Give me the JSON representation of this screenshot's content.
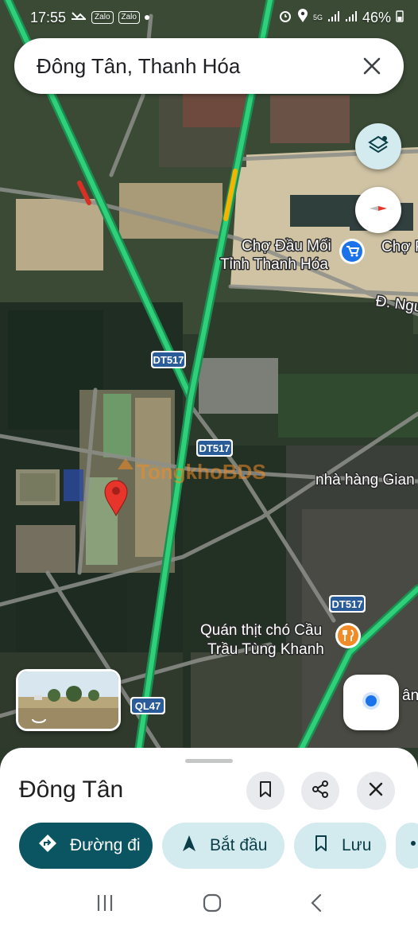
{
  "status_bar": {
    "time": "17:55",
    "notif_chip_1": "Zalo",
    "notif_chip_2": "Zalo",
    "network": "5G",
    "battery": "46%"
  },
  "search": {
    "query": "Đông Tân, Thanh Hóa"
  },
  "map": {
    "labels": {
      "market_line1": "Chợ Đầu Mối",
      "market_line2": "Tỉnh Thanh Hóa",
      "market2": "Chợ P",
      "street": "Đ. Ngu",
      "restaurant": "nhà hàng Gian",
      "dog_meat_line1": "Quán thịt chó Cầu",
      "dog_meat_line2": "Trầu Tùng Khanh",
      "edge_fragment": "ân",
      "watermark": "TongkhoBDS"
    },
    "route_shields": {
      "dt517_a": "DT517",
      "dt517_b": "DT517",
      "dt517_c": "DT517",
      "ql47": "QL47"
    }
  },
  "sheet": {
    "title": "Đông Tân",
    "actions": {
      "directions": "Đường đi",
      "start": "Bắt đầu",
      "save": "Lưu"
    }
  },
  "colors": {
    "primary": "#0b5563",
    "tonal": "#d3ebef",
    "highway": "#1fc46b",
    "pin": "#e8352b",
    "market_badge": "#1a73e8",
    "restaurant_badge": "#f28b25"
  }
}
